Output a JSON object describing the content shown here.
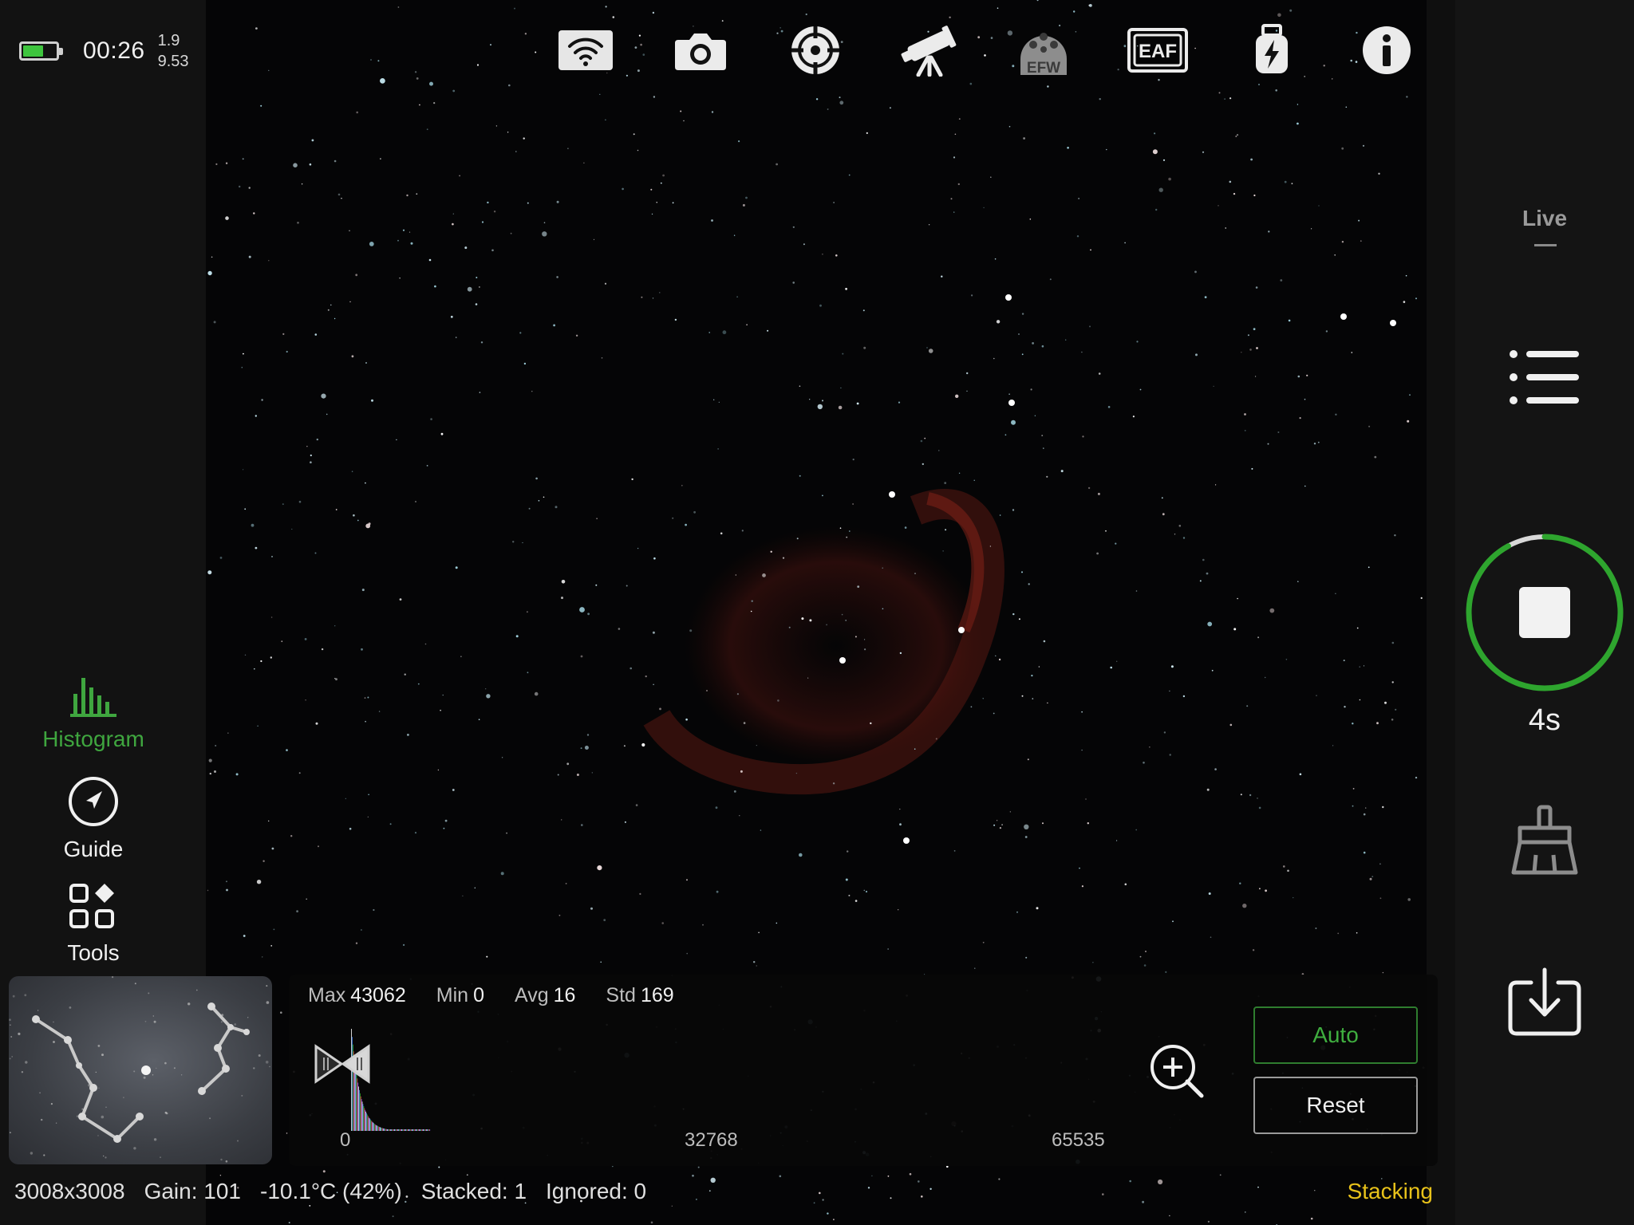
{
  "status": {
    "battery_level": 0.62,
    "clock": "00:26",
    "value_top": "1.9",
    "value_bottom": "9.53"
  },
  "left_tools": [
    {
      "label": "Histogram",
      "icon": "histogram-icon",
      "active": true
    },
    {
      "label": "Guide",
      "icon": "compass-icon",
      "active": false
    },
    {
      "label": "Tools",
      "icon": "tools-grid-icon",
      "active": false
    }
  ],
  "top_toolbar": [
    {
      "icon": "wifi-icon"
    },
    {
      "icon": "camera-icon"
    },
    {
      "icon": "crosshair-icon"
    },
    {
      "icon": "telescope-icon"
    },
    {
      "icon": "filter-wheel-icon",
      "label": "EFW"
    },
    {
      "icon": "focuser-icon",
      "label": "EAF"
    },
    {
      "icon": "usb-power-icon"
    },
    {
      "icon": "info-icon"
    }
  ],
  "histogram": {
    "max_label": "Max",
    "max_value": "43062",
    "min_label": "Min",
    "min_value": "0",
    "avg_label": "Avg",
    "avg_value": "16",
    "std_label": "Std",
    "std_value": "169",
    "axis": [
      "0",
      "32768",
      "65535"
    ],
    "auto_label": "Auto",
    "reset_label": "Reset"
  },
  "info_bar": {
    "resolution": "3008x3008",
    "gain": "Gain: 101",
    "temperature": "-10.1°C (42%)",
    "stacked": "Stacked: 1",
    "ignored": "Ignored: 0",
    "status": "Stacking"
  },
  "right_panel": {
    "mode_label": "Live",
    "timer": "4s",
    "capture_progress": 0.92
  },
  "colors": {
    "accent_green": "#3fa63f",
    "status_yellow": "#e8c21a",
    "battery_green": "#3ec43e"
  }
}
